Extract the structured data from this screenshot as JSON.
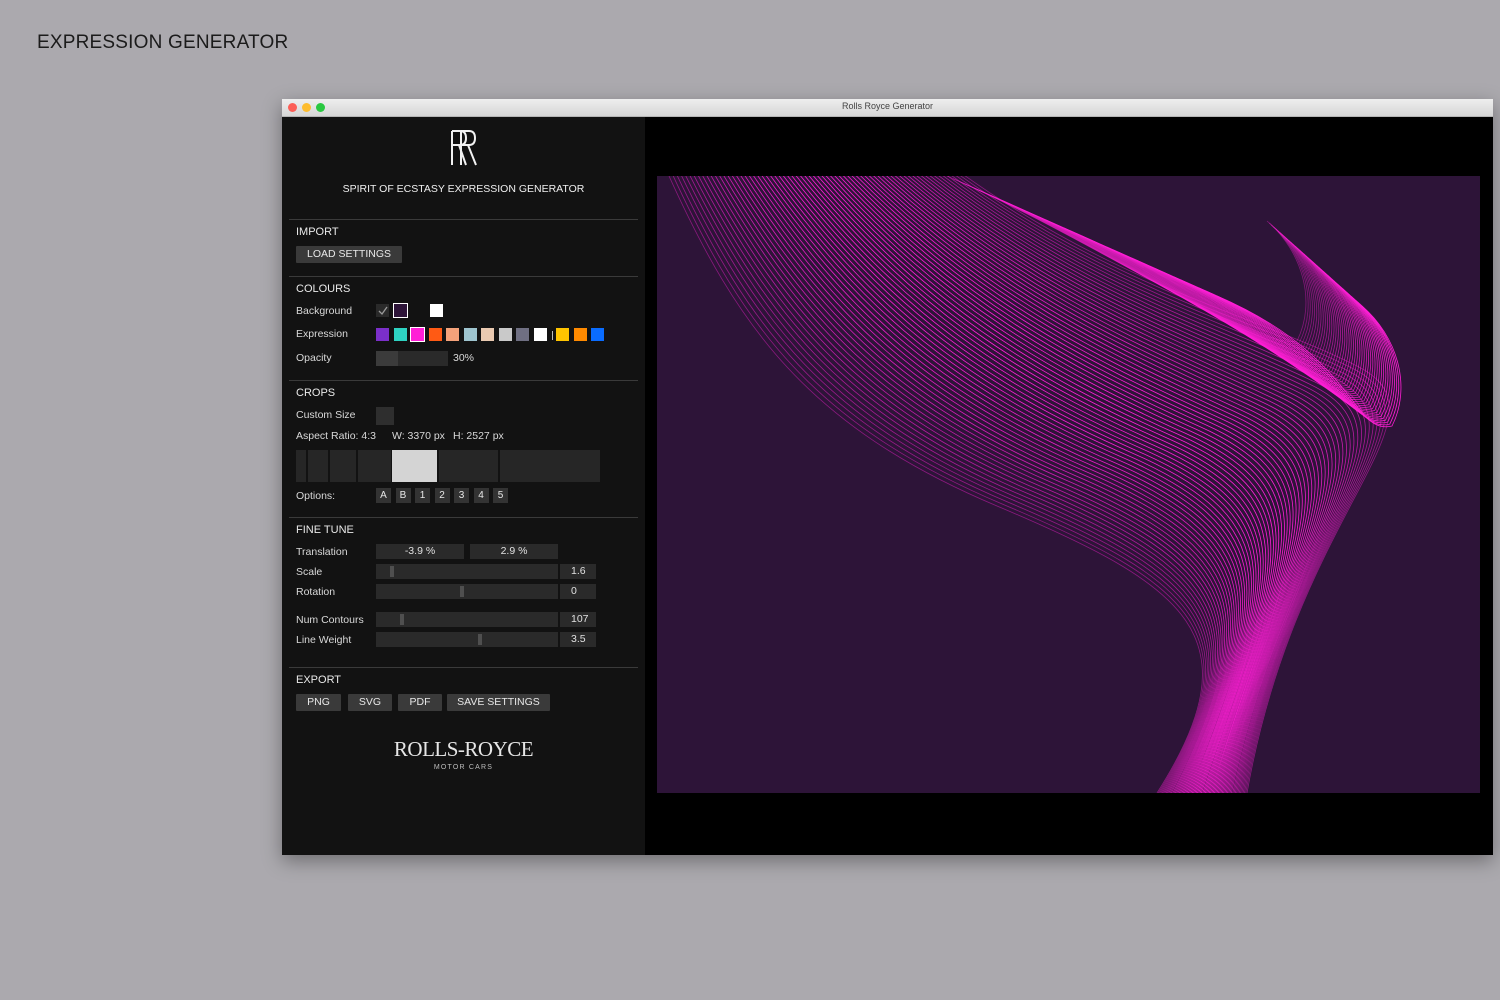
{
  "page": {
    "heading": "EXPRESSION GENERATOR"
  },
  "window": {
    "title": "Rolls Royce Generator"
  },
  "app": {
    "subtitle": "SPIRIT OF ECSTASY EXPRESSION GENERATOR",
    "brand_name": "ROLLS-ROYCE",
    "brand_sub": "MOTOR CARS"
  },
  "import": {
    "title": "IMPORT",
    "load_label": "LOAD SETTINGS"
  },
  "colours": {
    "title": "COLOURS",
    "background_label": "Background",
    "expression_label": "Expression",
    "opacity_label": "Opacity",
    "opacity_value": "30%",
    "opacity_fraction": 0.3,
    "background_swatches": [
      "#2a2a2a",
      "#2d1438",
      "#121212",
      "#ffffff"
    ],
    "background_selected": 1,
    "expression_swatches": [
      "#7b2fc9",
      "#2ed3c2",
      "#ff1fd6",
      "#ff5a14",
      "#f4a27a",
      "#9ec4cf",
      "#e9c9b0",
      "#c9c9c9",
      "#6f6f82",
      "#ffffff",
      "#ffc400",
      "#ff8a00",
      "#0a6cff"
    ],
    "expression_selected": 2
  },
  "crops": {
    "title": "CROPS",
    "custom_size_label": "Custom Size",
    "aspect_label": "Aspect Ratio: 4:3",
    "width_label": "W: 3370 px",
    "height_label": "H: 2527 px",
    "options_label": "Options:",
    "options": [
      "A",
      "B",
      "1",
      "2",
      "3",
      "4",
      "5"
    ],
    "selected_tile": 4
  },
  "fine_tune": {
    "title": "FINE TUNE",
    "translation_label": "Translation",
    "translation_x": "-3.9 %",
    "translation_y": "2.9 %",
    "scale_label": "Scale",
    "scale_value": "1.6",
    "rotation_label": "Rotation",
    "rotation_value": "0",
    "contours_label": "Num Contours",
    "contours_value": "107",
    "weight_label": "Line Weight",
    "weight_value": "3.5"
  },
  "export": {
    "title": "EXPORT",
    "png_label": "PNG",
    "svg_label": "SVG",
    "pdf_label": "PDF",
    "save_label": "SAVE SETTINGS"
  },
  "artwork": {
    "background": "#2d1438",
    "stroke": "#ff1fd6"
  }
}
